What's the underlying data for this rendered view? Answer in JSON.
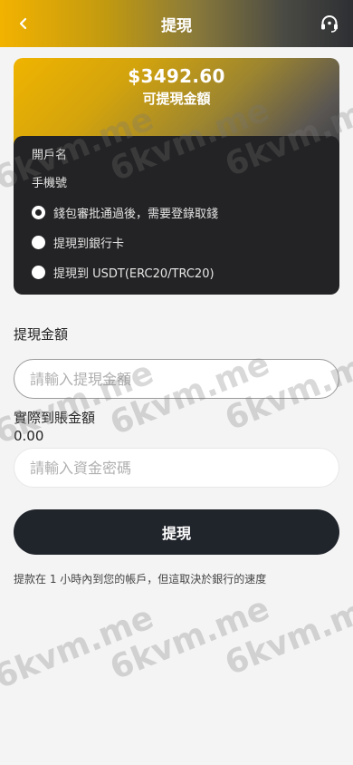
{
  "header": {
    "title": "提現",
    "back_icon": "chevron-left-icon",
    "support_icon": "headset-icon"
  },
  "balance": {
    "amount": "$3492.60",
    "label": "可提現金額"
  },
  "account_info": {
    "account_name_label": "開戶名",
    "phone_label": "手機號",
    "options": [
      {
        "label": "錢包審批通過後，需要登錄取錢",
        "selected": true
      },
      {
        "label": "提現到銀行卡",
        "selected": false
      },
      {
        "label": "提現到 USDT(ERC20/TRC20)",
        "selected": false
      }
    ]
  },
  "form": {
    "amount_label": "提現金額",
    "amount_placeholder": "請輸入提現金額",
    "received_label": "實際到賬金額",
    "received_value": "0.00",
    "password_placeholder": "請輸入資金密碼",
    "submit_label": "提現"
  },
  "note": "提款在 1 小時內到您的帳戶，但這取決於銀行的速度",
  "watermark": "6kvm.me",
  "colors": {
    "accent_gold": "#f3b200",
    "dark_panel": "#232325",
    "button_dark": "#20242b"
  }
}
